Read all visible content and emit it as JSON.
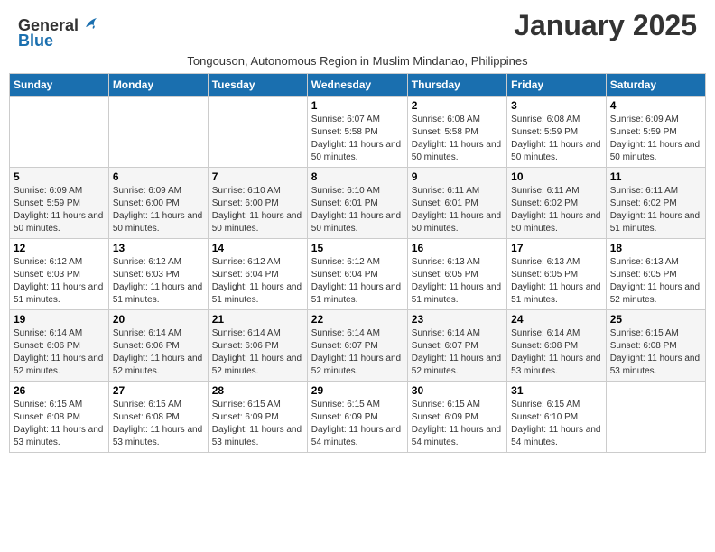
{
  "logo": {
    "general": "General",
    "blue": "Blue"
  },
  "title": "January 2025",
  "subtitle": "Tongouson, Autonomous Region in Muslim Mindanao, Philippines",
  "days_of_week": [
    "Sunday",
    "Monday",
    "Tuesday",
    "Wednesday",
    "Thursday",
    "Friday",
    "Saturday"
  ],
  "weeks": [
    [
      {
        "day": "",
        "info": ""
      },
      {
        "day": "",
        "info": ""
      },
      {
        "day": "",
        "info": ""
      },
      {
        "day": "1",
        "info": "Sunrise: 6:07 AM\nSunset: 5:58 PM\nDaylight: 11 hours and 50 minutes."
      },
      {
        "day": "2",
        "info": "Sunrise: 6:08 AM\nSunset: 5:58 PM\nDaylight: 11 hours and 50 minutes."
      },
      {
        "day": "3",
        "info": "Sunrise: 6:08 AM\nSunset: 5:59 PM\nDaylight: 11 hours and 50 minutes."
      },
      {
        "day": "4",
        "info": "Sunrise: 6:09 AM\nSunset: 5:59 PM\nDaylight: 11 hours and 50 minutes."
      }
    ],
    [
      {
        "day": "5",
        "info": "Sunrise: 6:09 AM\nSunset: 5:59 PM\nDaylight: 11 hours and 50 minutes."
      },
      {
        "day": "6",
        "info": "Sunrise: 6:09 AM\nSunset: 6:00 PM\nDaylight: 11 hours and 50 minutes."
      },
      {
        "day": "7",
        "info": "Sunrise: 6:10 AM\nSunset: 6:00 PM\nDaylight: 11 hours and 50 minutes."
      },
      {
        "day": "8",
        "info": "Sunrise: 6:10 AM\nSunset: 6:01 PM\nDaylight: 11 hours and 50 minutes."
      },
      {
        "day": "9",
        "info": "Sunrise: 6:11 AM\nSunset: 6:01 PM\nDaylight: 11 hours and 50 minutes."
      },
      {
        "day": "10",
        "info": "Sunrise: 6:11 AM\nSunset: 6:02 PM\nDaylight: 11 hours and 50 minutes."
      },
      {
        "day": "11",
        "info": "Sunrise: 6:11 AM\nSunset: 6:02 PM\nDaylight: 11 hours and 51 minutes."
      }
    ],
    [
      {
        "day": "12",
        "info": "Sunrise: 6:12 AM\nSunset: 6:03 PM\nDaylight: 11 hours and 51 minutes."
      },
      {
        "day": "13",
        "info": "Sunrise: 6:12 AM\nSunset: 6:03 PM\nDaylight: 11 hours and 51 minutes."
      },
      {
        "day": "14",
        "info": "Sunrise: 6:12 AM\nSunset: 6:04 PM\nDaylight: 11 hours and 51 minutes."
      },
      {
        "day": "15",
        "info": "Sunrise: 6:12 AM\nSunset: 6:04 PM\nDaylight: 11 hours and 51 minutes."
      },
      {
        "day": "16",
        "info": "Sunrise: 6:13 AM\nSunset: 6:05 PM\nDaylight: 11 hours and 51 minutes."
      },
      {
        "day": "17",
        "info": "Sunrise: 6:13 AM\nSunset: 6:05 PM\nDaylight: 11 hours and 51 minutes."
      },
      {
        "day": "18",
        "info": "Sunrise: 6:13 AM\nSunset: 6:05 PM\nDaylight: 11 hours and 52 minutes."
      }
    ],
    [
      {
        "day": "19",
        "info": "Sunrise: 6:14 AM\nSunset: 6:06 PM\nDaylight: 11 hours and 52 minutes."
      },
      {
        "day": "20",
        "info": "Sunrise: 6:14 AM\nSunset: 6:06 PM\nDaylight: 11 hours and 52 minutes."
      },
      {
        "day": "21",
        "info": "Sunrise: 6:14 AM\nSunset: 6:06 PM\nDaylight: 11 hours and 52 minutes."
      },
      {
        "day": "22",
        "info": "Sunrise: 6:14 AM\nSunset: 6:07 PM\nDaylight: 11 hours and 52 minutes."
      },
      {
        "day": "23",
        "info": "Sunrise: 6:14 AM\nSunset: 6:07 PM\nDaylight: 11 hours and 52 minutes."
      },
      {
        "day": "24",
        "info": "Sunrise: 6:14 AM\nSunset: 6:08 PM\nDaylight: 11 hours and 53 minutes."
      },
      {
        "day": "25",
        "info": "Sunrise: 6:15 AM\nSunset: 6:08 PM\nDaylight: 11 hours and 53 minutes."
      }
    ],
    [
      {
        "day": "26",
        "info": "Sunrise: 6:15 AM\nSunset: 6:08 PM\nDaylight: 11 hours and 53 minutes."
      },
      {
        "day": "27",
        "info": "Sunrise: 6:15 AM\nSunset: 6:08 PM\nDaylight: 11 hours and 53 minutes."
      },
      {
        "day": "28",
        "info": "Sunrise: 6:15 AM\nSunset: 6:09 PM\nDaylight: 11 hours and 53 minutes."
      },
      {
        "day": "29",
        "info": "Sunrise: 6:15 AM\nSunset: 6:09 PM\nDaylight: 11 hours and 54 minutes."
      },
      {
        "day": "30",
        "info": "Sunrise: 6:15 AM\nSunset: 6:09 PM\nDaylight: 11 hours and 54 minutes."
      },
      {
        "day": "31",
        "info": "Sunrise: 6:15 AM\nSunset: 6:10 PM\nDaylight: 11 hours and 54 minutes."
      },
      {
        "day": "",
        "info": ""
      }
    ]
  ]
}
